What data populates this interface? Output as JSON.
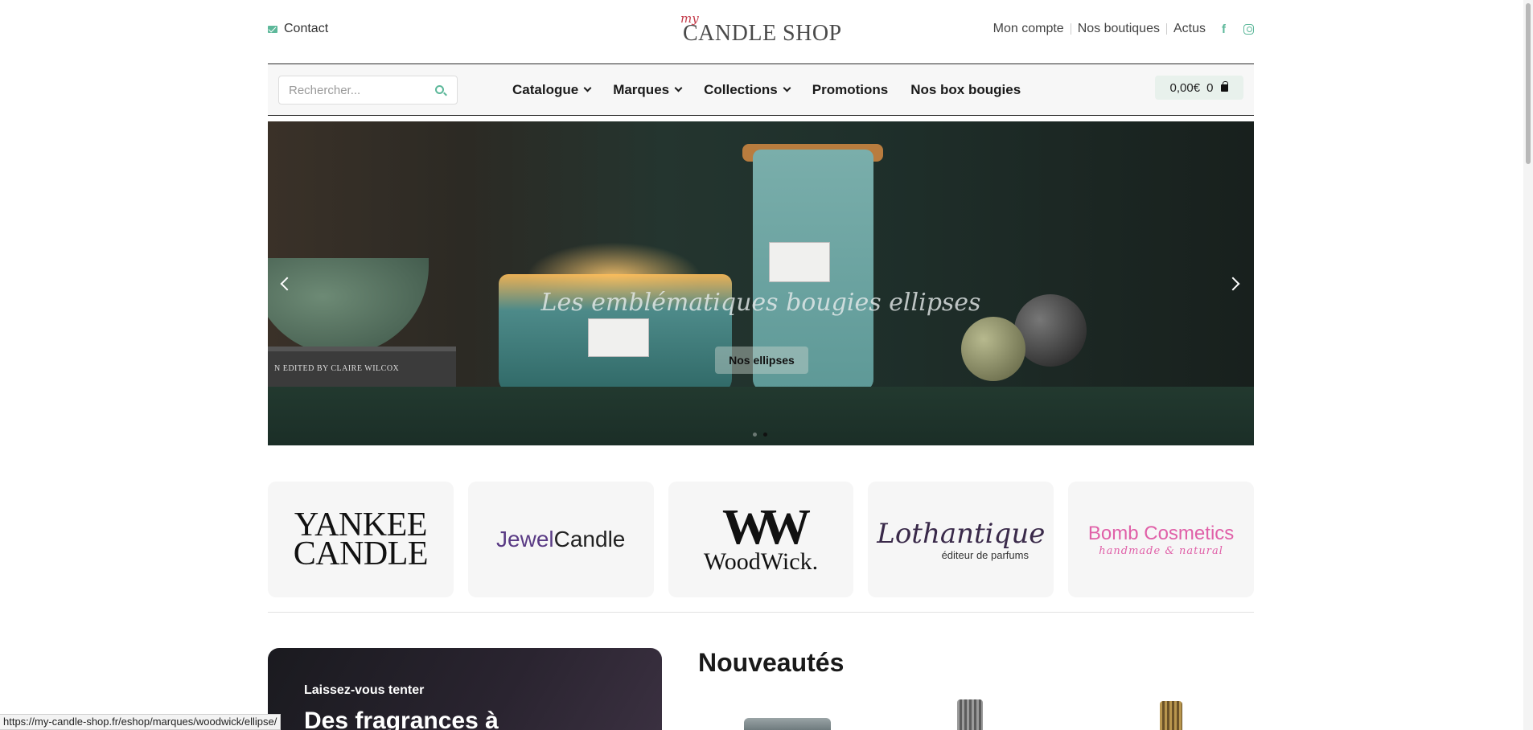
{
  "header": {
    "contact_label": "Contact",
    "logo_my": "my",
    "logo_text": "CANDLE SHOP",
    "links": [
      "Mon compte",
      "Nos boutiques",
      "Actus"
    ],
    "social_facebook": "f"
  },
  "nav": {
    "search_placeholder": "Rechercher...",
    "menu": [
      "Catalogue",
      "Marques",
      "Collections",
      "Promotions",
      "Nos box bougies"
    ],
    "cart_total": "0,00€",
    "cart_count": "0"
  },
  "hero": {
    "title": "Les emblématiques bougies ellipses",
    "button_label": "Nos ellipses",
    "book_text": "N   EDITED BY CLAIRE WILCOX",
    "slide_count": 2,
    "active_slide": 2
  },
  "brands": {
    "yankee_line1": "YANKEE",
    "yankee_line2": "CANDLE",
    "jewel_a": "Jewel",
    "jewel_b": "Candle",
    "woodwick_mark": "WW",
    "woodwick_name": "WoodWick.",
    "lothantique_name": "Lothantique",
    "lothantique_sub": "éditeur de parfums",
    "bomb_name": "Bomb Cosmetics",
    "bomb_tag": "handmade & natural"
  },
  "promo": {
    "kicker": "Laissez-vous tenter",
    "title": "Des fragrances à"
  },
  "news": {
    "title": "Nouveautés"
  },
  "status": {
    "url": "https://my-candle-shop.fr/eshop/marques/woodwick/ellipse/"
  },
  "colors": {
    "accent": "#5db89a",
    "cart_bg": "#e8f1ec",
    "logo_red": "#c43b4a"
  }
}
